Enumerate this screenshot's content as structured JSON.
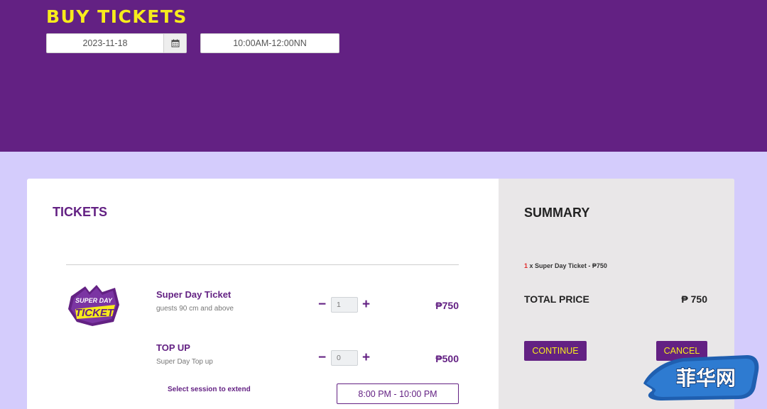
{
  "header": {
    "title": "BUY TICKETS",
    "date": "2023-11-18",
    "time_slot": "10:00AM-12:00NN"
  },
  "tickets": {
    "heading": "TICKETS",
    "logo_lines": [
      "SUPER DAY",
      "TICKET"
    ],
    "items": [
      {
        "name": "Super Day Ticket",
        "subtitle": "guests 90 cm and above",
        "quantity": "1",
        "price": "₱750"
      },
      {
        "name": "TOP UP",
        "subtitle": "Super Day Top up",
        "quantity": "0",
        "price": "₱500"
      }
    ],
    "minus_symbol": "−",
    "plus_symbol": "+",
    "session_label": "Select session to extend",
    "session_value": "8:00 PM - 10:00 PM"
  },
  "summary": {
    "heading": "SUMMARY",
    "line_count": "1",
    "line_text": " x Super Day Ticket - ₱750",
    "total_label": "TOTAL PRICE",
    "total_value": "₱ 750",
    "continue_label": "CONTINUE",
    "cancel_label": "CANCEL"
  },
  "watermark": {
    "text": "菲华网"
  },
  "icons": {
    "calendar": "calendar-icon",
    "ticket_logo": "super-day-ticket-logo"
  },
  "colors": {
    "brand_purple": "#632183",
    "accent_yellow": "#f7ec1c",
    "page_background": "#d4ccfc",
    "summary_background": "#e9e7e8",
    "highlight_red": "#e22b2b"
  }
}
